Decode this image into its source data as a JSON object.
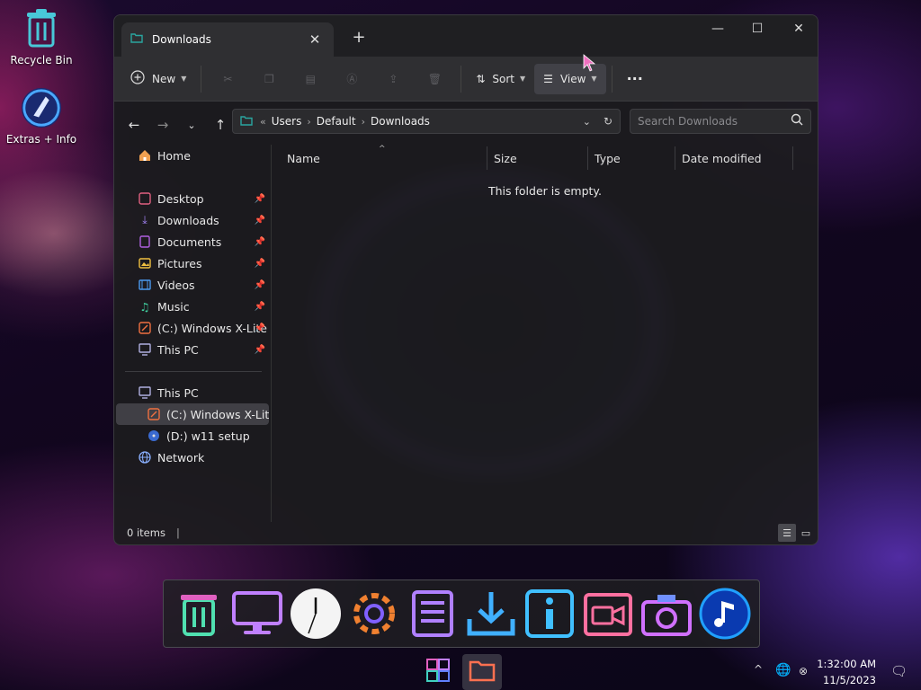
{
  "desktop": {
    "icons": [
      {
        "label": "Recycle Bin",
        "icon": "recycle-bin-icon"
      },
      {
        "label": "Extras + Info",
        "icon": "extras-info-icon"
      }
    ]
  },
  "window": {
    "tab_title": "Downloads",
    "new_tab_label": "+",
    "controls": {
      "minimize": "—",
      "maximize": "☐",
      "close": "✕"
    }
  },
  "toolbar": {
    "new_label": "New",
    "sort_label": "Sort",
    "view_label": "View",
    "more_label": "···"
  },
  "address": {
    "overflow": "«",
    "crumbs": [
      "Users",
      "Default",
      "Downloads"
    ]
  },
  "search": {
    "placeholder": "Search Downloads"
  },
  "sidebar": {
    "home": "Home",
    "quick": [
      {
        "label": "Desktop",
        "icon": "desktop-icon"
      },
      {
        "label": "Downloads",
        "icon": "downloads-icon"
      },
      {
        "label": "Documents",
        "icon": "documents-icon"
      },
      {
        "label": "Pictures",
        "icon": "pictures-icon"
      },
      {
        "label": "Videos",
        "icon": "videos-icon"
      },
      {
        "label": "Music",
        "icon": "music-icon"
      },
      {
        "label": "(C:) Windows X-Lite",
        "icon": "drive-icon"
      },
      {
        "label": "This PC",
        "icon": "pc-icon"
      }
    ],
    "tree": [
      {
        "label": "This PC",
        "icon": "pc-icon"
      },
      {
        "label": "(C:) Windows X-Lite",
        "icon": "drive-icon",
        "selected": true
      },
      {
        "label": "(D:) w11 setup",
        "icon": "dvd-icon"
      },
      {
        "label": "Network",
        "icon": "network-icon"
      }
    ]
  },
  "columns": [
    "Name",
    "Size",
    "Type",
    "Date modified"
  ],
  "empty_message": "This folder is empty.",
  "status": {
    "items": "0 items"
  },
  "clock": {
    "time": "1:32:00 AM",
    "date": "11/5/2023"
  },
  "colors": {
    "accent": "#2aa6a0",
    "window_bg": "#1c1c1e"
  }
}
